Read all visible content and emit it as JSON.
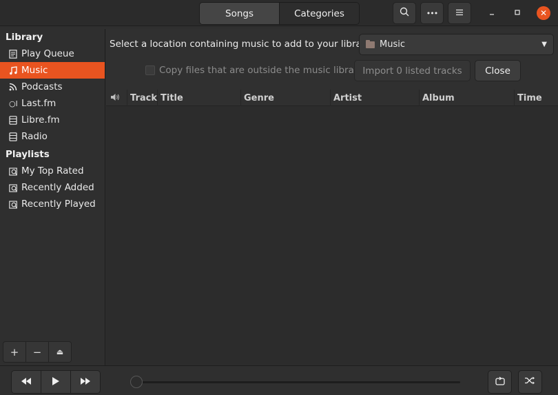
{
  "header": {
    "tabs": [
      {
        "label": "Songs",
        "active": true
      },
      {
        "label": "Categories",
        "active": false
      }
    ],
    "icons": [
      "search-icon",
      "more-icon",
      "menu-icon",
      "minimize-icon",
      "maximize-icon",
      "close-icon"
    ]
  },
  "sidebar": {
    "library_heading": "Library",
    "library_items": [
      {
        "label": "Play Queue",
        "icon": "play-queue-icon"
      },
      {
        "label": "Music",
        "icon": "music-note-icon",
        "selected": true
      },
      {
        "label": "Podcasts",
        "icon": "podcast-icon"
      },
      {
        "label": "Last.fm",
        "icon": "lastfm-icon"
      },
      {
        "label": "Libre.fm",
        "icon": "librefm-icon"
      },
      {
        "label": "Radio",
        "icon": "radio-icon"
      }
    ],
    "playlists_heading": "Playlists",
    "playlist_items": [
      {
        "label": "My Top Rated",
        "icon": "smart-playlist-icon"
      },
      {
        "label": "Recently Added",
        "icon": "smart-playlist-icon"
      },
      {
        "label": "Recently Played",
        "icon": "smart-playlist-icon"
      }
    ],
    "bottom_buttons": [
      "add-icon",
      "remove-icon",
      "eject-icon"
    ]
  },
  "import_bar": {
    "location_label": "Select a location containing music to add to your library:",
    "location_value": "Music",
    "copy_checkbox_label": "Copy files that are outside the music library",
    "copy_checked": false,
    "import_button": "Import 0 listed tracks",
    "close_button": "Close"
  },
  "table": {
    "columns": [
      "Track",
      "Title",
      "Genre",
      "Artist",
      "Album",
      "Time"
    ],
    "rows": []
  },
  "player": {
    "progress": 0,
    "transport_icons": [
      "previous-icon",
      "play-icon",
      "next-icon"
    ],
    "mode_icons": [
      "repeat-icon",
      "shuffle-icon"
    ]
  },
  "colors": {
    "accent": "#e95420",
    "background": "#2f2f2f"
  }
}
